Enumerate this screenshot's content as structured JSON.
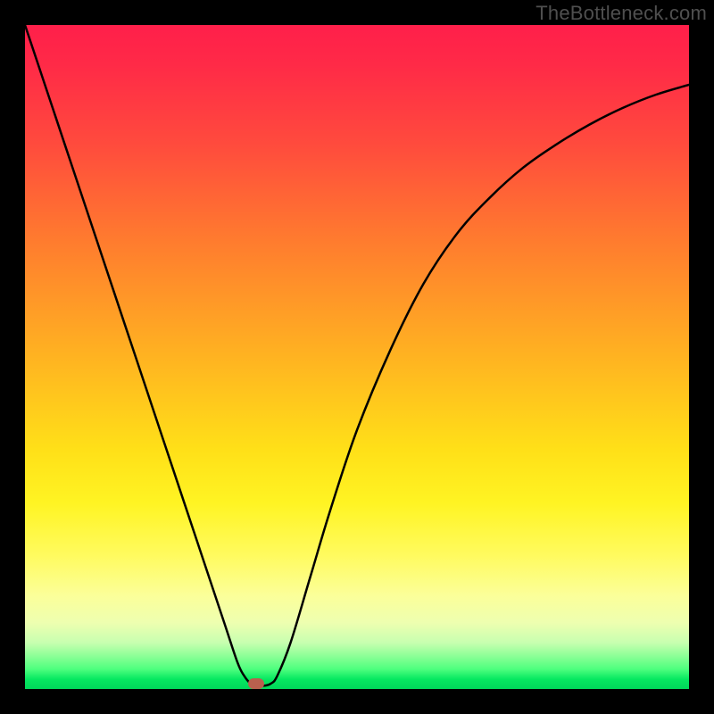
{
  "watermark": "TheBottleneck.com",
  "chart_data": {
    "type": "line",
    "title": "",
    "xlabel": "",
    "ylabel": "",
    "xlim": [
      0,
      100
    ],
    "ylim": [
      0,
      100
    ],
    "grid": false,
    "legend": false,
    "series": [
      {
        "name": "bottleneck_curve",
        "x": [
          0,
          3,
          6,
          9,
          12,
          15,
          18,
          21,
          24,
          27,
          30,
          32,
          33,
          34,
          35,
          36,
          37,
          38,
          40,
          43,
          46,
          50,
          55,
          60,
          65,
          70,
          75,
          80,
          85,
          90,
          95,
          100
        ],
        "values": [
          100,
          91,
          82,
          73,
          64,
          55,
          46,
          37,
          28,
          19,
          10,
          4,
          2,
          0.8,
          0.5,
          0.5,
          0.8,
          2,
          7,
          17,
          27,
          39,
          51,
          61,
          68.5,
          74,
          78.5,
          82,
          85,
          87.5,
          89.5,
          91
        ]
      }
    ],
    "marker": {
      "x": 34.8,
      "y": 0.8,
      "color": "#b8604e"
    },
    "gradient_stops": [
      {
        "pos": 0,
        "color": "#ff1f4a"
      },
      {
        "pos": 0.18,
        "color": "#ff4b3d"
      },
      {
        "pos": 0.33,
        "color": "#ff7d2e"
      },
      {
        "pos": 0.5,
        "color": "#ffb321"
      },
      {
        "pos": 0.64,
        "color": "#ffe018"
      },
      {
        "pos": 0.8,
        "color": "#fffb60"
      },
      {
        "pos": 0.93,
        "color": "#c8ffb0"
      },
      {
        "pos": 1.0,
        "color": "#00d85a"
      }
    ]
  },
  "frame": {
    "outer_size": 800,
    "border": 28,
    "border_color": "#000000",
    "plot_size": 744
  }
}
